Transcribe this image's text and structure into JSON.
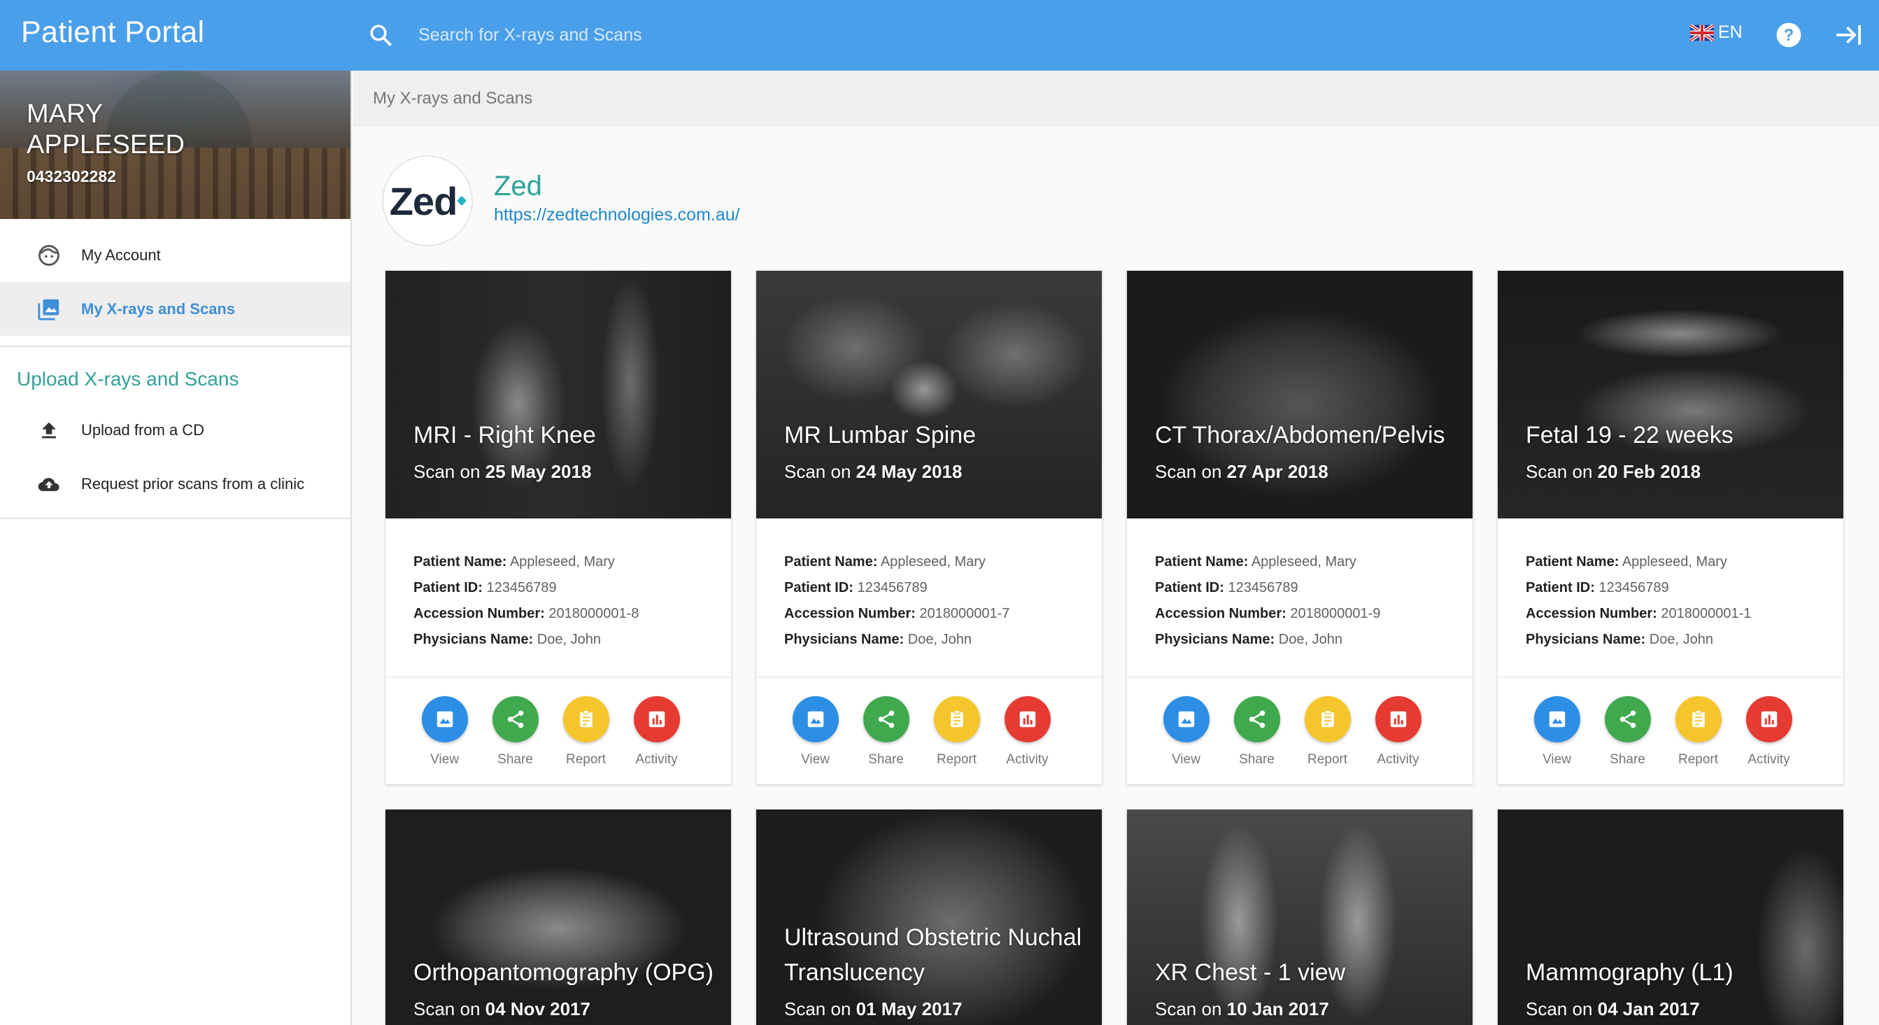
{
  "header": {
    "title": "Patient Portal",
    "search_placeholder": "Search for X-rays and Scans",
    "language": "EN"
  },
  "profile": {
    "name": "MARY APPLESEED",
    "phone": "0432302282"
  },
  "sidebar": {
    "account_items": [
      {
        "label": "My Account",
        "icon": "face-icon"
      },
      {
        "label": "My X-rays and Scans",
        "icon": "photo-library-icon",
        "active": true
      }
    ],
    "upload_section_title": "Upload X-rays and Scans",
    "upload_items": [
      {
        "label": "Upload from a CD",
        "icon": "upload-icon"
      },
      {
        "label": "Request prior scans from a clinic",
        "icon": "cloud-upload-icon"
      }
    ]
  },
  "breadcrumb": "My X-rays and Scans",
  "provider": {
    "logo_text": "Zed",
    "name": "Zed",
    "url": "https://zedtechnologies.com.au/"
  },
  "labels": {
    "scan_on": "Scan on",
    "patient_name": "Patient Name:",
    "patient_id": "Patient ID:",
    "accession_number": "Accession Number:",
    "physicians_name": "Physicians Name:"
  },
  "actions": [
    "View",
    "Share",
    "Report",
    "Activity"
  ],
  "colors": {
    "topbar": "#4a9fea",
    "accent_teal": "#2aa39a",
    "view": "#2d8ee6",
    "share": "#40a94e",
    "report": "#f5c62c",
    "activity": "#e53b32"
  },
  "scans": [
    {
      "title": "MRI - Right Knee",
      "date": "25 May 2018",
      "patient_name": "Appleseed, Mary",
      "patient_id": "123456789",
      "accession": "2018000001-8",
      "physician": "Doe, John"
    },
    {
      "title": "MR Lumbar Spine",
      "date": "24 May 2018",
      "patient_name": "Appleseed, Mary",
      "patient_id": "123456789",
      "accession": "2018000001-7",
      "physician": "Doe, John"
    },
    {
      "title": "CT Thorax/Abdomen/Pelvis",
      "date": "27 Apr 2018",
      "patient_name": "Appleseed, Mary",
      "patient_id": "123456789",
      "accession": "2018000001-9",
      "physician": "Doe, John"
    },
    {
      "title": "Fetal 19 - 22 weeks",
      "date": "20 Feb 2018",
      "patient_name": "Appleseed, Mary",
      "patient_id": "123456789",
      "accession": "2018000001-1",
      "physician": "Doe, John"
    },
    {
      "title": "Orthopantomography (OPG)",
      "date": "04 Nov 2017"
    },
    {
      "title": "Ultrasound Obstetric Nuchal Translucency",
      "date": "01 May 2017"
    },
    {
      "title": "XR Chest - 1 view",
      "date": "10 Jan 2017"
    },
    {
      "title": "Mammography (L1)",
      "date": "04 Jan 2017"
    }
  ]
}
